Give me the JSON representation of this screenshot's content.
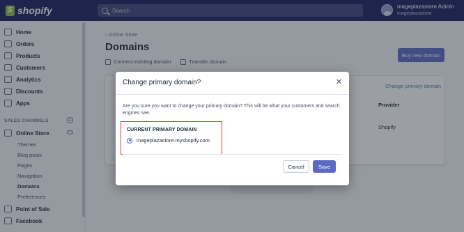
{
  "topbar": {
    "logo_text": "shopify",
    "search_placeholder": "Search",
    "user_name": "mageplazastore Admin",
    "user_store": "mageplazastore"
  },
  "sidebar": {
    "items": [
      {
        "label": "Home",
        "icon": "home-icon"
      },
      {
        "label": "Orders",
        "icon": "orders-icon"
      },
      {
        "label": "Products",
        "icon": "tag-icon"
      },
      {
        "label": "Customers",
        "icon": "customers-icon"
      },
      {
        "label": "Analytics",
        "icon": "analytics-icon"
      },
      {
        "label": "Discounts",
        "icon": "discount-icon"
      },
      {
        "label": "Apps",
        "icon": "apps-icon"
      }
    ],
    "section_label": "SALES CHANNELS",
    "online_store": "Online Store",
    "sub_items": [
      "Themes",
      "Blog posts",
      "Pages",
      "Navigation",
      "Domains",
      "Preferences"
    ],
    "point_of_sale": "Point of Sale",
    "facebook": "Facebook"
  },
  "main": {
    "breadcrumb": "Online Store",
    "title": "Domains",
    "connect_label": "Connect existing domain",
    "transfer_label": "Transfer domain",
    "buy_button": "Buy new domain",
    "card_link": "Change primary domain",
    "column_provider": "Provider",
    "provider_value": "Shopify"
  },
  "modal": {
    "title": "Change primary domain?",
    "body": "Are you sure you want to change your primary domain? This will be what your customers and search engines see.",
    "current_label": "CURRENT PRIMARY DOMAIN",
    "domain": "mageplazastore.myshopify.com",
    "cancel": "Cancel",
    "save": "Save"
  },
  "colors": {
    "topbar": "#1c2260",
    "primary": "#5c6ac4",
    "highlight": "#e03c3c"
  }
}
